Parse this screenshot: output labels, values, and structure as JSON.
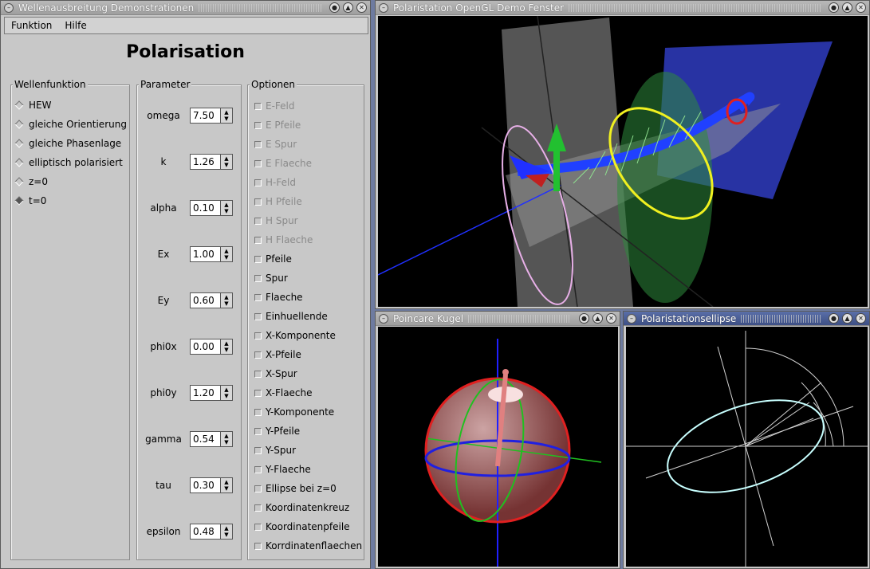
{
  "main_window": {
    "title": "Wellenausbreitung Demonstrationen",
    "menu": [
      "Funktion",
      "Hilfe"
    ],
    "heading": "Polarisation",
    "wellenfunktion": {
      "label": "Wellenfunktion",
      "options": [
        {
          "label": "HEW",
          "selected": false
        },
        {
          "label": "gleiche Orientierung",
          "selected": false
        },
        {
          "label": "gleiche Phasenlage",
          "selected": false
        },
        {
          "label": "elliptisch polarisiert",
          "selected": false
        },
        {
          "label": "z=0",
          "selected": false
        },
        {
          "label": "t=0",
          "selected": true
        }
      ]
    },
    "parameter": {
      "label": "Parameter",
      "items": [
        {
          "name": "omega",
          "value": "7.50"
        },
        {
          "name": "k",
          "value": "1.26"
        },
        {
          "name": "alpha",
          "value": "0.10"
        },
        {
          "name": "Ex",
          "value": "1.00"
        },
        {
          "name": "Ey",
          "value": "0.60"
        },
        {
          "name": "phi0x",
          "value": "0.00"
        },
        {
          "name": "phi0y",
          "value": "1.20"
        },
        {
          "name": "gamma",
          "value": "0.54"
        },
        {
          "name": "tau",
          "value": "0.30"
        },
        {
          "name": "epsilon",
          "value": "0.48"
        }
      ]
    },
    "optionen": {
      "label": "Optionen",
      "items": [
        {
          "label": "E-Feld",
          "enabled": false
        },
        {
          "label": "E Pfeile",
          "enabled": false
        },
        {
          "label": "E Spur",
          "enabled": false
        },
        {
          "label": "E Flaeche",
          "enabled": false
        },
        {
          "label": "H-Feld",
          "enabled": false
        },
        {
          "label": "H Pfeile",
          "enabled": false
        },
        {
          "label": "H Spur",
          "enabled": false
        },
        {
          "label": "H Flaeche",
          "enabled": false
        },
        {
          "label": "Pfeile",
          "enabled": true
        },
        {
          "label": "Spur",
          "enabled": true
        },
        {
          "label": "Flaeche",
          "enabled": true
        },
        {
          "label": "Einhuellende",
          "enabled": true
        },
        {
          "label": "X-Komponente",
          "enabled": true
        },
        {
          "label": "X-Pfeile",
          "enabled": true
        },
        {
          "label": "X-Spur",
          "enabled": true
        },
        {
          "label": "X-Flaeche",
          "enabled": true
        },
        {
          "label": "Y-Komponente",
          "enabled": true
        },
        {
          "label": "Y-Pfeile",
          "enabled": true
        },
        {
          "label": "Y-Spur",
          "enabled": true
        },
        {
          "label": "Y-Flaeche",
          "enabled": true
        },
        {
          "label": "Ellipse bei z=0",
          "enabled": true
        },
        {
          "label": "Koordinatenkreuz",
          "enabled": true
        },
        {
          "label": "Koordinatenpfeile",
          "enabled": true
        },
        {
          "label": "Korrdinatenflaechen",
          "enabled": true
        }
      ]
    }
  },
  "gl_window": {
    "title": "Polaristation OpenGL Demo Fenster"
  },
  "poincare_window": {
    "title": "Poincare Kugel"
  },
  "ellipse_window": {
    "title": "Polaristationsellipse"
  },
  "colors": {
    "background": "#6e7ba0",
    "panel": "#c8c8c8",
    "active_title": "#4a5d96",
    "canvas": "#000000"
  }
}
